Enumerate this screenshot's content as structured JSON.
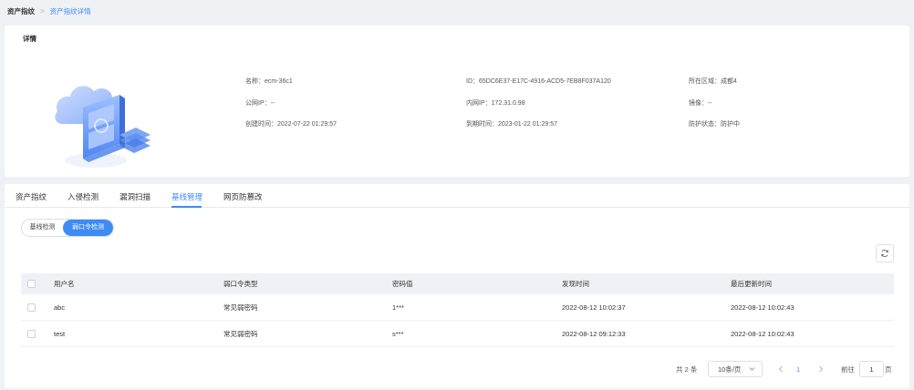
{
  "breadcrumb": {
    "root": "资产指纹",
    "separator": ">",
    "current": "资产指纹详情"
  },
  "detail": {
    "title": "详情",
    "fields": [
      {
        "text": "名称：ecm-36c1"
      },
      {
        "text": "ID：65DC6E37-E17C-4916-ACD5-7EB8F037A120"
      },
      {
        "text": "所在区域：成都4"
      },
      {
        "text": "公网IP：--"
      },
      {
        "text": "内网IP：172.31.0.98"
      },
      {
        "text": "镜像：--"
      },
      {
        "text": "创建时间：2022-07-22 01:29:57"
      },
      {
        "text": "到期时间：2023-01-22 01:29:57"
      },
      {
        "text": "防护状态：防护中"
      }
    ]
  },
  "tabs": [
    {
      "label": "资产指纹",
      "active": false
    },
    {
      "label": "入侵检测",
      "active": false
    },
    {
      "label": "漏洞扫描",
      "active": false
    },
    {
      "label": "基线管理",
      "active": true
    },
    {
      "label": "网页防篡改",
      "active": false
    }
  ],
  "segment": {
    "options": [
      "基线检测",
      "弱口令检测"
    ],
    "selected": "弱口令检测"
  },
  "refresh_icon": "refresh-icon",
  "table": {
    "columns": [
      "用户名",
      "弱口令类型",
      "密码值",
      "发现时间",
      "最后更新时间"
    ],
    "rows": [
      [
        "abc",
        "常见弱密码",
        "1***",
        "2022-08-12 10:02:37",
        "2022-08-12 10:02:43"
      ],
      [
        "test",
        "常见弱密码",
        "s***",
        "2022-08-12 09:12:33",
        "2022-08-12 10:02:43"
      ]
    ]
  },
  "pagination": {
    "total": "共 2 条",
    "page_size": "10条/页",
    "current_page": "1",
    "goto_label": "前往",
    "goto_value": "1",
    "page_suffix": "页"
  },
  "colors": {
    "accent": "#3d8bf5",
    "background": "#eff1f4",
    "header_bg": "#eef1f6"
  }
}
